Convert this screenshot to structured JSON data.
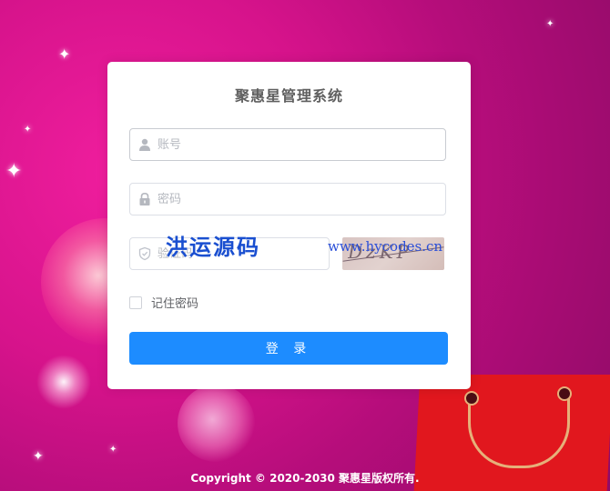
{
  "login": {
    "title": "聚惠星管理系统",
    "account_placeholder": "账号",
    "password_placeholder": "密码",
    "captcha_placeholder": "验证码",
    "captcha_text": "DzKP",
    "remember_label": "记住密码",
    "remember_checked": false,
    "login_button": "登 录"
  },
  "watermark": {
    "cn": "洪运源码",
    "url": "www.hycodes.cn"
  },
  "footer": {
    "copyright": "Copyright © 2020-2030 聚惠星版权所有."
  },
  "colors": {
    "primary": "#1d8cff",
    "background": "#d6138b",
    "card": "#ffffff"
  }
}
